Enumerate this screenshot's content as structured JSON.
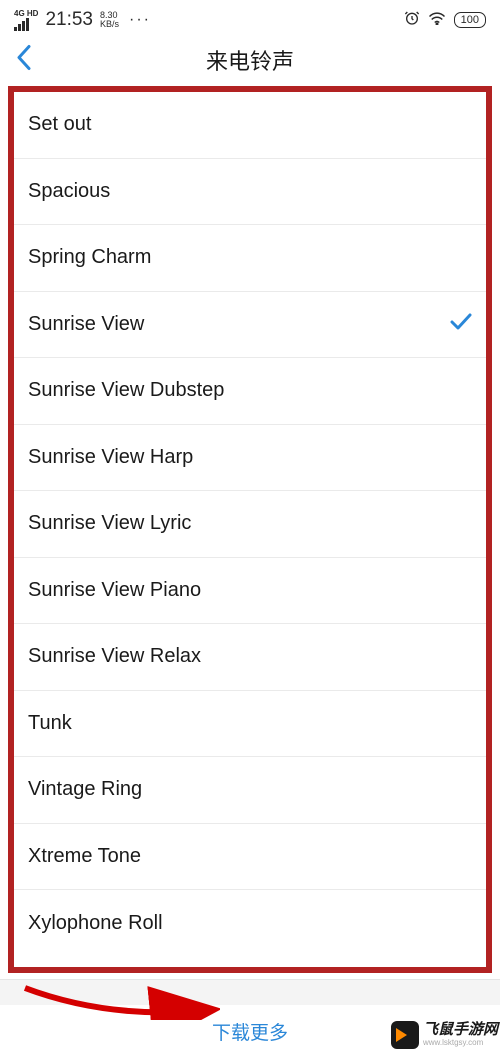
{
  "status": {
    "network_label": "4G HD",
    "time": "21:53",
    "speed_value": "8.30",
    "speed_unit": "KB/s",
    "more": "···",
    "battery": "100"
  },
  "header": {
    "title": "来电铃声"
  },
  "ringtones": [
    {
      "label": "Set out",
      "selected": false
    },
    {
      "label": "Spacious",
      "selected": false
    },
    {
      "label": "Spring Charm",
      "selected": false
    },
    {
      "label": "Sunrise View",
      "selected": true
    },
    {
      "label": "Sunrise View Dubstep",
      "selected": false
    },
    {
      "label": "Sunrise View Harp",
      "selected": false
    },
    {
      "label": "Sunrise View Lyric",
      "selected": false
    },
    {
      "label": "Sunrise View Piano",
      "selected": false
    },
    {
      "label": "Sunrise View Relax",
      "selected": false
    },
    {
      "label": "Tunk",
      "selected": false
    },
    {
      "label": "Vintage Ring",
      "selected": false
    },
    {
      "label": "Xtreme Tone",
      "selected": false
    },
    {
      "label": "Xylophone Roll",
      "selected": false
    }
  ],
  "bottom": {
    "download_more": "下载更多"
  },
  "watermark": {
    "main": "飞鼠手游网",
    "sub": "www.lsktgsy.com"
  }
}
